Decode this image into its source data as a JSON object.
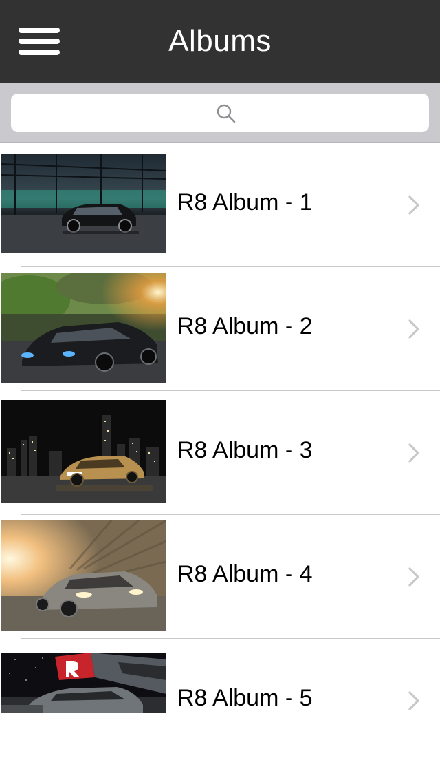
{
  "navbar": {
    "title": "Albums",
    "menu_icon": "hamburger-menu-icon",
    "background": "#323232"
  },
  "search": {
    "placeholder": "",
    "icon": "search-icon",
    "background": "#c9c9ce"
  },
  "albums": [
    {
      "label": "R8 Album - 1",
      "thumbnail": "car-in-warehouse-photo",
      "accent": "#2a2e33"
    },
    {
      "label": "R8 Album - 2",
      "thumbnail": "car-on-road-with-trees-photo",
      "accent": "#3e4a2c"
    },
    {
      "label": "R8 Album - 3",
      "thumbnail": "gold-car-city-night-photo",
      "accent": "#0f0f0f"
    },
    {
      "label": "R8 Album - 4",
      "thumbnail": "car-motion-blur-sunset-photo",
      "accent": "#9a8870"
    },
    {
      "label": "R8 Album - 5",
      "thumbnail": "car-at-auto-show-photo",
      "accent": "#1a1a1a"
    }
  ],
  "chevron_icon": "chevron-right-icon"
}
